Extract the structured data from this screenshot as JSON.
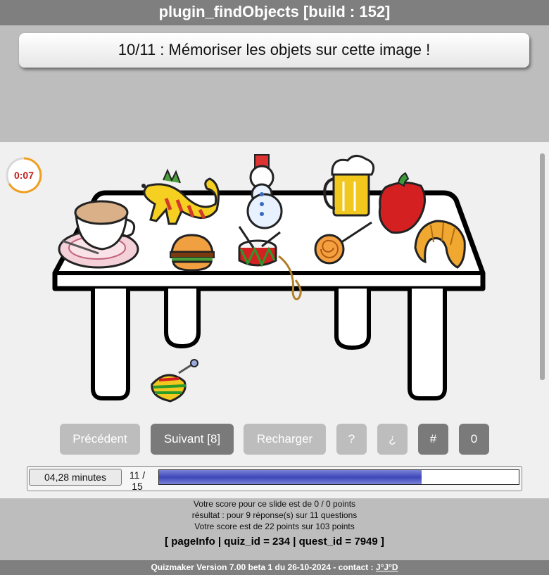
{
  "app": {
    "title": "plugin_findObjects [build : 152]"
  },
  "question": {
    "text": "10/11 : Mémoriser les objets sur cette image !"
  },
  "timer": {
    "text": "0:07"
  },
  "stage": {
    "objects": [
      "coffee-cup",
      "dinosaur",
      "snowman",
      "beer-mug",
      "red-pepper",
      "burger",
      "drum",
      "lollipop",
      "croissant",
      "spinning-top"
    ]
  },
  "buttons": {
    "prev": "Précédent",
    "next": "Suivant [8]",
    "reload": "Recharger",
    "help": "?",
    "inverted_question": "¿",
    "hash": "#",
    "zero": "0"
  },
  "progress": {
    "time": "04,28 minutes",
    "count": "11 / 15",
    "fraction": 0.73
  },
  "score": {
    "line1": "Votre score pour ce slide est de 0 / 0 points",
    "line2": "résultat : pour 9 réponse(s) sur 11 questions",
    "line3": "Votre score est de 22 points sur 103 points"
  },
  "page_info": "[ pageInfo | quiz_id = 234 | quest_id = 7949 ]",
  "footer": {
    "text": "Quizmaker Version 7.00 beta 1 du 26-10-2024 - contact : ",
    "contact": "J°J°D"
  },
  "colors": {
    "timer_arc": "#f0a020",
    "timer_text": "#c01a1a",
    "progress_fill": "#4a52c0"
  }
}
